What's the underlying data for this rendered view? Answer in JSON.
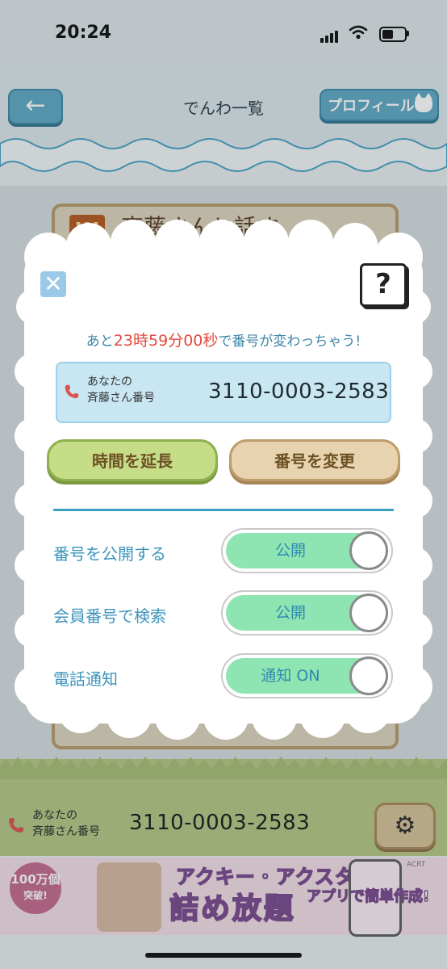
{
  "status_bar": {
    "time": "20:24"
  },
  "header": {
    "title": "でんわ一覧",
    "back_label": "←",
    "profile_label": "プロフィール"
  },
  "background_card": {
    "badge": "W",
    "title": "斉藤さんと話す"
  },
  "modal": {
    "close_label": "✕",
    "help_label": "?",
    "countdown": {
      "prefix": "あと",
      "hours": "23",
      "hours_unit": "時",
      "minutes": "59",
      "minutes_unit": "分",
      "seconds": "00",
      "seconds_unit": "秒",
      "suffix": "で番号が変わっちゃう!"
    },
    "number_box": {
      "label_line1": "あなたの",
      "label_line2": "斉藤さん番号",
      "number": "3110-0003-2583"
    },
    "extend_button": "時間を延長",
    "change_button": "番号を変更",
    "settings": [
      {
        "label": "番号を公開する",
        "toggle_text": "公開",
        "on": true
      },
      {
        "label": "会員番号で検索",
        "toggle_text": "公開",
        "on": true
      },
      {
        "label": "電話通知",
        "toggle_text": "通知 ON",
        "on": true
      }
    ]
  },
  "bottom_bar": {
    "label_line1": "あなたの",
    "label_line2": "斉藤さん番号",
    "number": "3110-0003-2583",
    "settings_icon": "gear-icon"
  },
  "ad_banner": {
    "badge_main": "100万個",
    "badge_sub": "突破!",
    "title_line1": "アクキー・アクスタ",
    "title_line2": "詰め放題",
    "subtitle": "アプリで簡単作成!",
    "logo": "ACRT"
  },
  "colors": {
    "accent_blue": "#3d95bb",
    "countdown_red": "#e24a3b",
    "toggle_on": "#8fe5b2",
    "extend_green": "#c6dd88",
    "change_tan": "#e8d3b0"
  }
}
